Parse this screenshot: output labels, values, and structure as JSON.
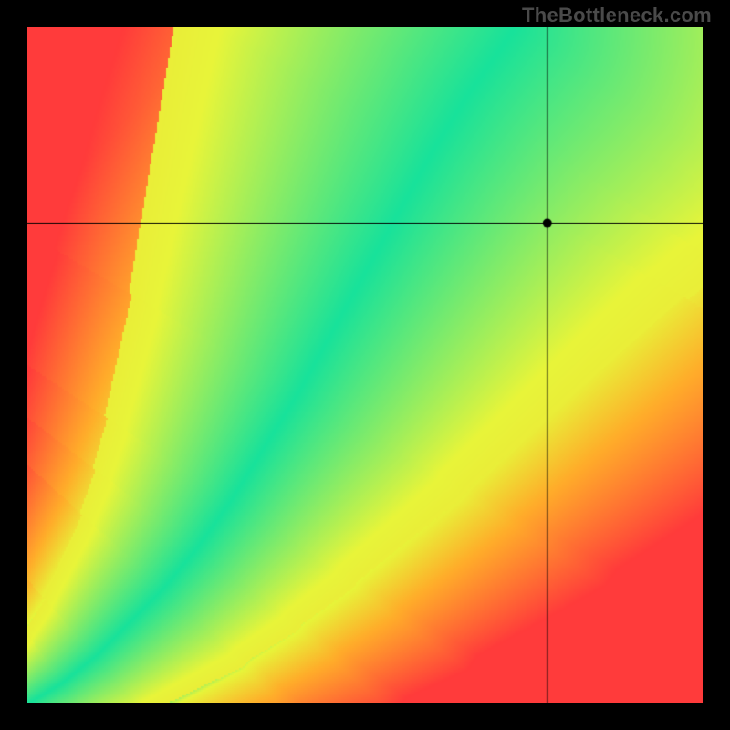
{
  "watermark": "TheBottleneck.com",
  "chart_data": {
    "type": "heatmap",
    "title": "",
    "xlabel": "",
    "ylabel": "",
    "xlim": [
      0,
      1
    ],
    "ylim": [
      0,
      1
    ],
    "marker": {
      "x": 0.77,
      "y": 0.71
    },
    "crosshair": {
      "x": 0.77,
      "y": 0.71
    },
    "ridge": {
      "description": "Ideal-match curve (green ridge) as (x, y) fractions of plot area, origin lower-left.",
      "points": [
        [
          0.0,
          0.0
        ],
        [
          0.05,
          0.03
        ],
        [
          0.1,
          0.07
        ],
        [
          0.15,
          0.12
        ],
        [
          0.2,
          0.17
        ],
        [
          0.25,
          0.23
        ],
        [
          0.3,
          0.3
        ],
        [
          0.35,
          0.38
        ],
        [
          0.4,
          0.46
        ],
        [
          0.45,
          0.55
        ],
        [
          0.5,
          0.64
        ],
        [
          0.55,
          0.73
        ],
        [
          0.6,
          0.82
        ],
        [
          0.65,
          0.9
        ],
        [
          0.7,
          0.97
        ],
        [
          0.72,
          1.0
        ]
      ],
      "half_width_start": 0.012,
      "half_width_end": 0.085
    },
    "secondary_band": {
      "description": "Yellow tolerance band to the right of the green ridge, approximate center line.",
      "points": [
        [
          0.0,
          0.0
        ],
        [
          0.1,
          0.04
        ],
        [
          0.2,
          0.1
        ],
        [
          0.3,
          0.18
        ],
        [
          0.4,
          0.27
        ],
        [
          0.5,
          0.37
        ],
        [
          0.6,
          0.47
        ],
        [
          0.7,
          0.58
        ],
        [
          0.8,
          0.68
        ],
        [
          0.9,
          0.79
        ],
        [
          1.0,
          0.9
        ]
      ]
    },
    "colors": {
      "best": "#18e29b",
      "good": "#e8f53a",
      "mid": "#ffae2a",
      "bad": "#ff3b3b",
      "marker": "#000000",
      "crosshair": "#000000"
    },
    "field_samples": {
      "description": "Sampled bottleneck-% field (0 = perfect green, 100 = worst red). 11x11 grid, row 0 is y=0 (bottom).",
      "grid_size": 11,
      "values": [
        [
          0,
          45,
          75,
          90,
          96,
          98,
          99,
          99,
          100,
          100,
          100
        ],
        [
          40,
          8,
          30,
          60,
          80,
          90,
          94,
          97,
          98,
          99,
          99
        ],
        [
          70,
          35,
          5,
          25,
          55,
          74,
          85,
          91,
          95,
          97,
          98
        ],
        [
          85,
          62,
          30,
          4,
          22,
          48,
          68,
          80,
          88,
          92,
          95
        ],
        [
          92,
          78,
          55,
          26,
          3,
          20,
          44,
          63,
          76,
          85,
          90
        ],
        [
          96,
          88,
          72,
          50,
          22,
          3,
          20,
          42,
          60,
          73,
          82
        ],
        [
          98,
          93,
          83,
          67,
          44,
          18,
          4,
          22,
          42,
          58,
          70
        ],
        [
          99,
          96,
          90,
          79,
          62,
          40,
          16,
          5,
          22,
          42,
          57
        ],
        [
          99,
          98,
          94,
          87,
          75,
          58,
          36,
          14,
          6,
          24,
          42
        ],
        [
          100,
          99,
          97,
          92,
          84,
          72,
          54,
          32,
          12,
          8,
          26
        ],
        [
          100,
          99,
          98,
          95,
          90,
          82,
          68,
          50,
          30,
          12,
          10
        ]
      ]
    }
  }
}
